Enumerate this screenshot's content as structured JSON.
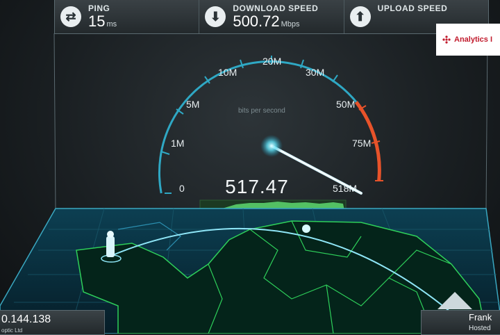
{
  "stats": {
    "ping": {
      "label": "PING",
      "value": "15",
      "unit": "ms",
      "icon": "swap-arrows-icon"
    },
    "download": {
      "label": "DOWNLOAD SPEED",
      "value": "500.72",
      "unit": "Mbps",
      "icon": "arrow-down-icon"
    },
    "upload": {
      "label": "UPLOAD SPEED",
      "value": "",
      "unit": "",
      "icon": "arrow-up-icon"
    }
  },
  "logo": {
    "text": "Analytics I",
    "color": "#c11a2c"
  },
  "gauge": {
    "ticks": [
      "0",
      "1M",
      "5M",
      "10M",
      "20M",
      "30M",
      "50M",
      "75M",
      "518M"
    ],
    "subtitle": "bits per second",
    "readout": "517.47",
    "needle_fraction": 0.97,
    "accent": "#33c9e6",
    "warn": "#e8532a"
  },
  "client": {
    "ip": "0.144.138",
    "isp": "optic Ltd"
  },
  "server": {
    "city": "Frank",
    "note": "Hosted"
  }
}
